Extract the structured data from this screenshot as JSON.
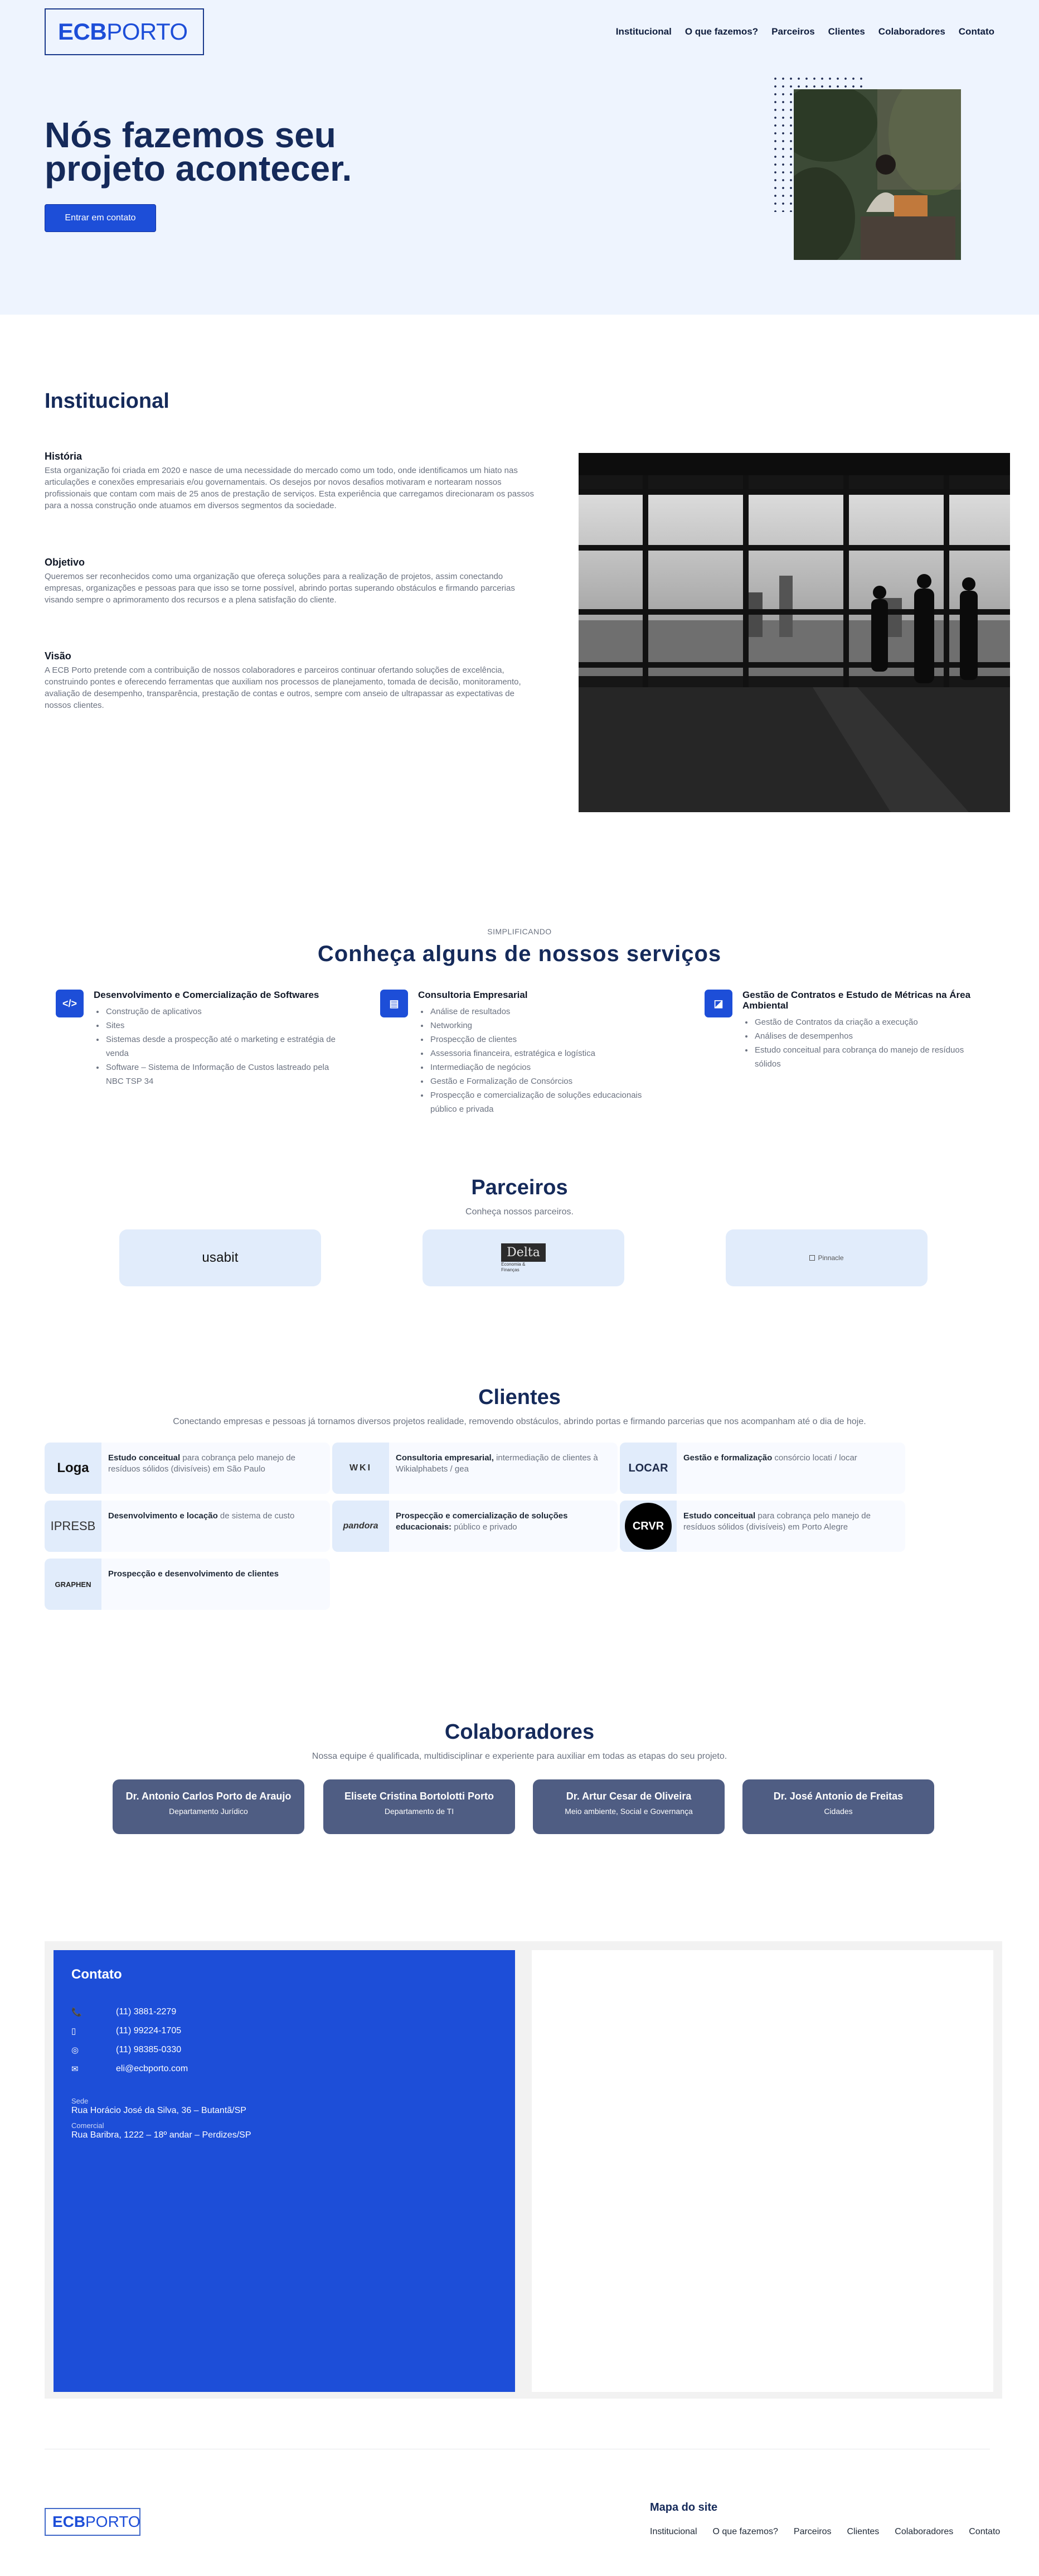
{
  "header": {
    "logo_bold": "ECB",
    "logo_light": "PORTO",
    "nav": [
      "Institucional",
      "O que fazemos?",
      "Parceiros",
      "Clientes",
      "Colaboradores",
      "Contato"
    ]
  },
  "hero": {
    "title": "Nós fazemos seu projeto acontecer.",
    "cta": "Entrar em contato"
  },
  "institucional": {
    "title": "Institucional",
    "blocks": [
      {
        "heading": "História",
        "text": "Esta organização foi criada em 2020 e nasce de uma necessidade do mercado como um todo, onde identificamos um hiato nas articulações e conexões empresariais e/ou governamentais. Os desejos por novos desafios motivaram e nortearam nossos profissionais que contam com mais de 25 anos de prestação de serviços. Esta experiência que carregamos direcionaram os passos para a nossa construção onde atuamos em diversos segmentos da sociedade."
      },
      {
        "heading": "Objetivo",
        "text": "Queremos ser reconhecidos como uma organização que ofereça soluções para a realização de projetos, assim conectando empresas, organizações e pessoas para que isso se torne possível, abrindo portas superando obstáculos e firmando parcerias visando sempre o aprimoramento dos recursos e a plena satisfação do cliente."
      },
      {
        "heading": "Visão",
        "text": "A ECB Porto pretende com a contribuição de nossos colaboradores e parceiros continuar ofertando soluções de excelência, construindo pontes e oferecendo ferramentas que auxiliam nos processos de planejamento, tomada de decisão, monitoramento, avaliação de desempenho, transparência, prestação de contas e outros, sempre com anseio de ultrapassar as expectativas de nossos clientes."
      }
    ]
  },
  "servicos": {
    "eyebrow": "SIMPLIFICANDO",
    "title": "Conheça alguns de nossos serviços",
    "items": [
      {
        "icon": "code-icon",
        "title": "Desenvolvimento e Comercialização de Softwares",
        "bullets": [
          "Construção de aplicativos",
          "Sites",
          "Sistemas desde a prospecção até o marketing e estratégia de venda",
          "Software – Sistema de Informação de Custos lastreado pela NBC TSP 34"
        ]
      },
      {
        "icon": "document-icon",
        "title": "Consultoria Empresarial",
        "bullets": [
          "Análise de resultados",
          "Networking",
          "Prospecção de clientes",
          "Assessoria financeira, estratégica e logística",
          "Intermediação de negócios",
          "Gestão e Formalização de Consórcios",
          "Prospecção e comercialização de soluções educacionais público e privada"
        ]
      },
      {
        "icon": "chart-icon",
        "title": "Gestão de Contratos e Estudo de Métricas na Área Ambiental",
        "bullets": [
          "Gestão de Contratos da criação a execução",
          "Análises de desempenhos",
          "Estudo conceitual para cobrança do manejo de resíduos sólidos"
        ]
      }
    ]
  },
  "parceiros": {
    "title": "Parceiros",
    "subtitle": "Conheça nossos parceiros.",
    "logos": [
      {
        "name": "usabit"
      },
      {
        "name": "Delta",
        "tag1": "Economia &",
        "tag2": "Finanças"
      },
      {
        "name": "Pinnacle"
      }
    ]
  },
  "clientes": {
    "title": "Clientes",
    "subtitle": "Conectando empresas e pessoas já tornamos diversos projetos realidade, removendo obstáculos, abrindo portas e firmando parcerias que nos acompanham até o dia de hoje.",
    "items": [
      {
        "logo": "Loga",
        "bold": "Estudo conceitual",
        "rest": " para cobrança pelo manejo de resíduos sólidos (divisíveis) em São Paulo"
      },
      {
        "logo": "WKI",
        "bold": "Consultoria empresarial,",
        "rest": " intermediação de clientes à Wikialphabets / gea"
      },
      {
        "logo": "LOCAR",
        "bold": "Gestão e formalização",
        "rest": " consórcio locati / locar"
      },
      {
        "logo": "IPRESB",
        "bold": "Desenvolvimento e locação",
        "rest": " de sistema de custo"
      },
      {
        "logo": "pandora",
        "bold": "Prospecção e comercialização de soluções educacionais:",
        "rest": " público e privado"
      },
      {
        "logo": "CRVR",
        "bold": "Estudo conceitual",
        "rest": " para cobrança pelo manejo de resíduos sólidos (divisíveis) em Porto Alegre"
      },
      {
        "logo": "GRAPHEN",
        "bold": "Prospecção e desenvolvimento de clientes",
        "rest": ""
      }
    ]
  },
  "colaboradores": {
    "title": "Colaboradores",
    "subtitle": "Nossa equipe é qualificada, multidisciplinar e experiente para auxiliar em todas as etapas do seu projeto.",
    "people": [
      {
        "name": "Dr. Antonio Carlos Porto de Araujo",
        "role": "Departamento Jurídico"
      },
      {
        "name": "Elisete Cristina Bortolotti Porto",
        "role": "Departamento de TI"
      },
      {
        "name": "Dr. Artur Cesar de Oliveira",
        "role": "Meio ambiente, Social e Governança"
      },
      {
        "name": "Dr. José Antonio de Freitas",
        "role": "Cidades"
      }
    ]
  },
  "contato": {
    "title": "Contato",
    "phones": [
      {
        "icon": "phone-icon",
        "glyph": "📞",
        "value": "(11) 3881-2279"
      },
      {
        "icon": "mobile-icon",
        "glyph": "▯",
        "value": "(11) 99224-1705"
      },
      {
        "icon": "whatsapp-icon",
        "glyph": "◎",
        "value": "(11) 98385-0330"
      },
      {
        "icon": "mail-icon",
        "glyph": "✉",
        "value": "eli@ecbporto.com"
      }
    ],
    "addresses": [
      {
        "label": "Sede",
        "value": "Rua Horácio José da Silva, 36 – Butantã/SP"
      },
      {
        "label": "Comercial",
        "value": "Rua Baribra, 1222 – 18º andar – Perdizes/SP"
      }
    ]
  },
  "footer": {
    "logo_bold": "ECB",
    "logo_light": "PORTO",
    "sitemap_title": "Mapa do site",
    "nav": [
      "Institucional",
      "O que fazemos?",
      "Parceiros",
      "Clientes",
      "Colaboradores",
      "Contato"
    ]
  },
  "colors": {
    "primary": "#1d4ed8",
    "navy": "#152a5a",
    "hero_bg": "#eef4fe",
    "card_bg": "#e1ecfb",
    "colab_card": "#4f5d83"
  }
}
